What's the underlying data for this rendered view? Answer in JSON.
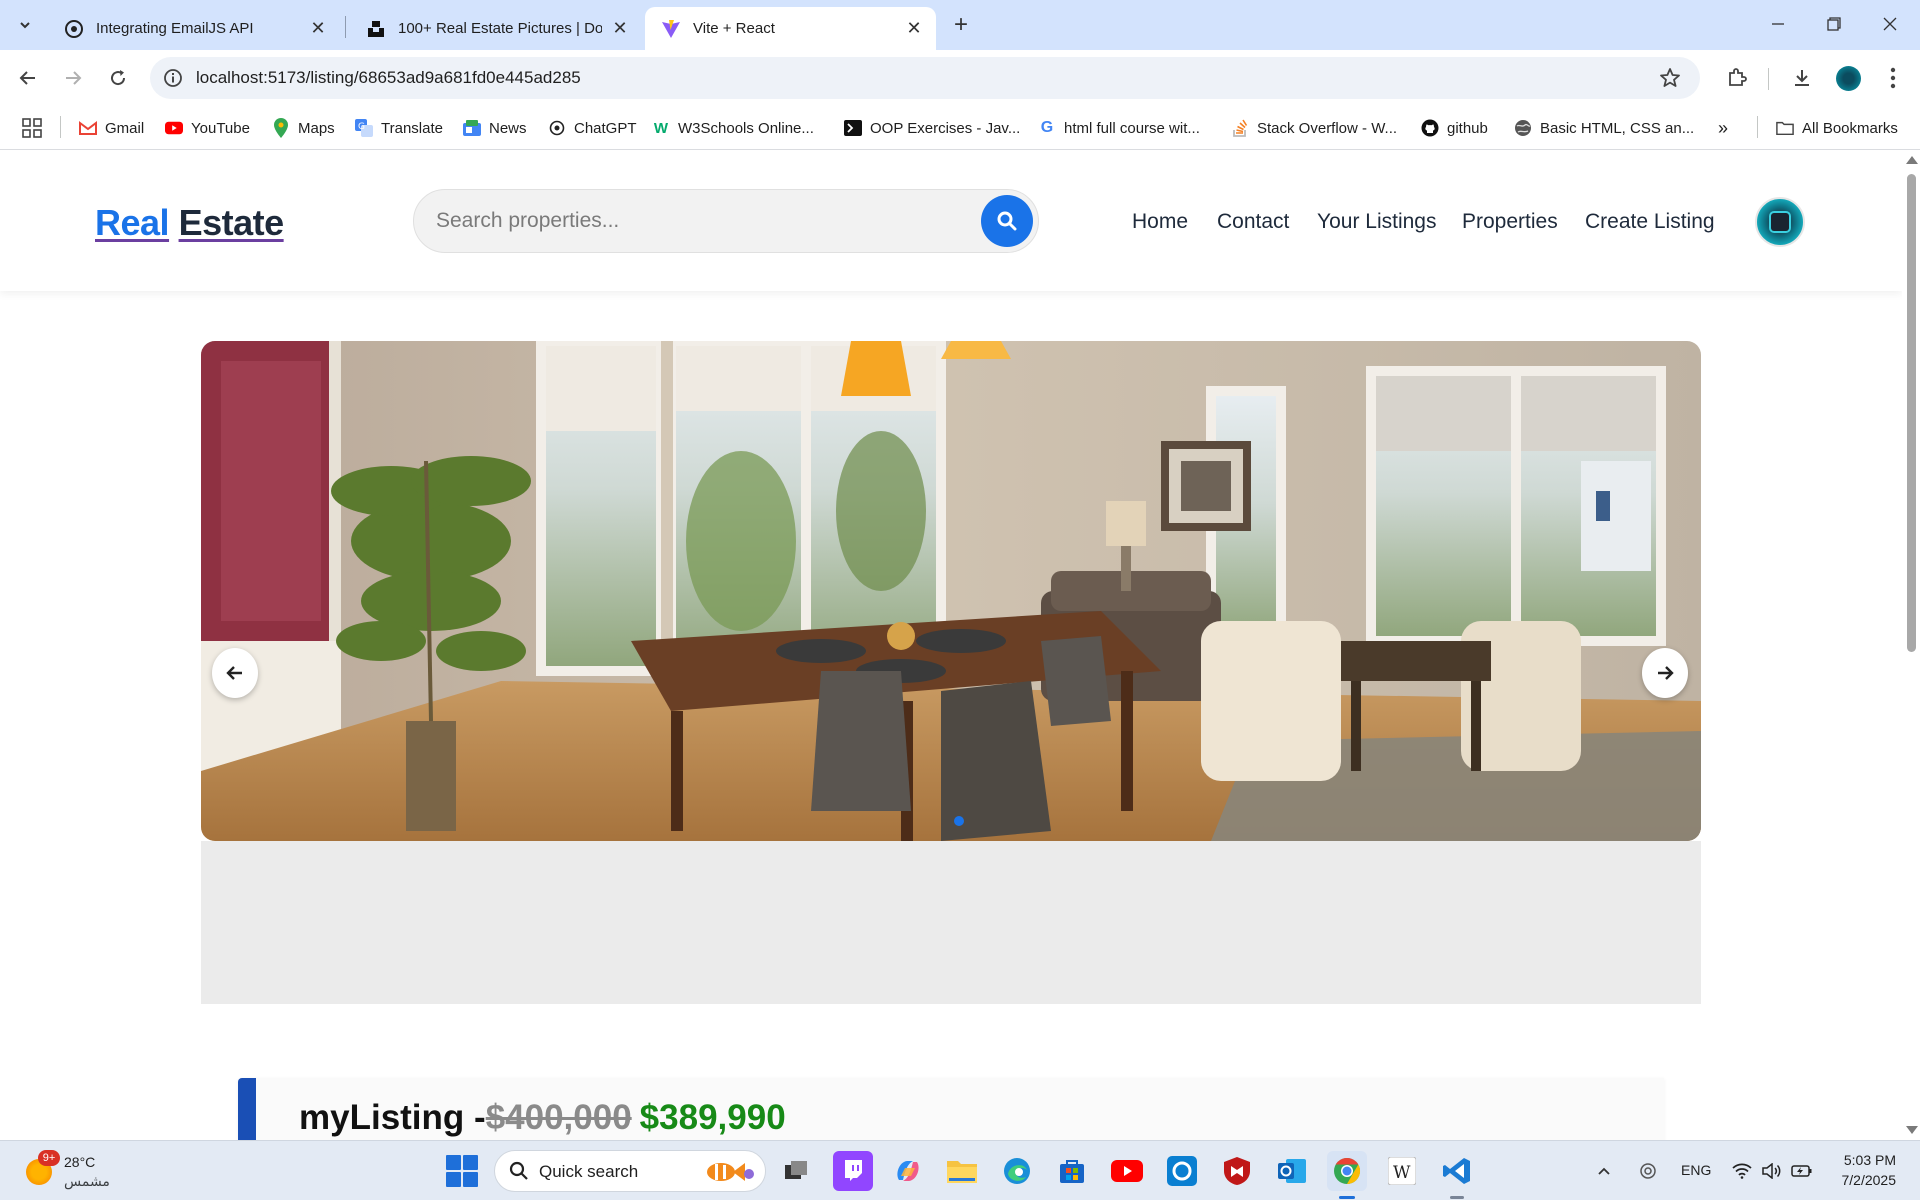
{
  "browser": {
    "tabs": [
      {
        "title": "Integrating EmailJS API",
        "active": false
      },
      {
        "title": "100+ Real Estate Pictures | Dow",
        "active": false
      },
      {
        "title": "Vite + React",
        "active": true
      }
    ],
    "url": "localhost:5173/listing/68653ad9a681fd0e445ad285",
    "bookmarks": [
      "Gmail",
      "YouTube",
      "Maps",
      "Translate",
      "News",
      "ChatGPT",
      "W3Schools Online...",
      "OOP Exercises - Jav...",
      "html full course wit...",
      "Stack Overflow - W...",
      "github",
      "Basic HTML, CSS an..."
    ],
    "all_bookmarks": "All Bookmarks"
  },
  "site": {
    "logo_part1": "Real",
    "logo_part2": "Estate",
    "search_placeholder": "Search properties...",
    "nav": [
      "Home",
      "Contact",
      "Your Listings",
      "Properties",
      "Create Listing"
    ]
  },
  "listing": {
    "name_prefix": "myListing -",
    "old_price": "$400,000",
    "new_price": "$389,990"
  },
  "taskbar": {
    "weather_badge": "9+",
    "temperature": "28°C",
    "weather_condition": "مشمس",
    "search_label": "Quick search",
    "language": "ENG",
    "time": "5:03 PM",
    "date": "7/2/2025"
  },
  "colors": {
    "accent": "#1a73e8",
    "card_border": "#1a4fb5",
    "sale_price": "#178a17",
    "tabstrip": "#d3e3fd"
  }
}
